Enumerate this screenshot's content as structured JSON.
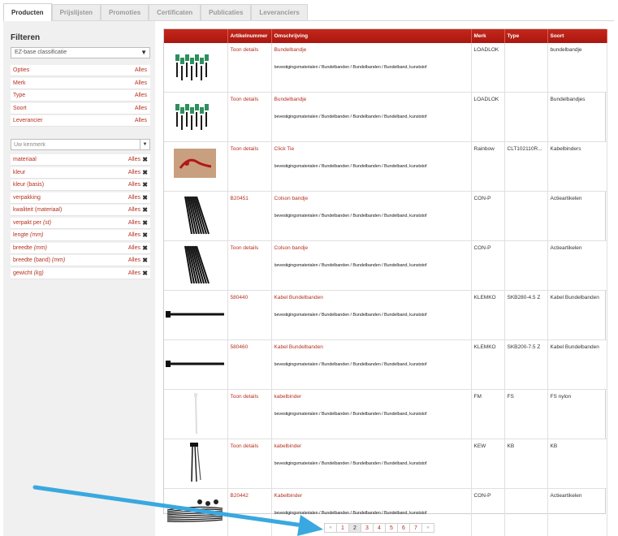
{
  "tabs": [
    {
      "label": "Producten",
      "active": true
    },
    {
      "label": "Prijslijsten",
      "active": false
    },
    {
      "label": "Promoties",
      "active": false
    },
    {
      "label": "Certificaten",
      "active": false
    },
    {
      "label": "Publicaties",
      "active": false
    },
    {
      "label": "Leveranciers",
      "active": false
    }
  ],
  "sidebar": {
    "title": "Filteren",
    "classification_select": "EZ-base classificatie",
    "filters": [
      {
        "label": "Opties",
        "value": "Alles"
      },
      {
        "label": "Merk",
        "value": "Alles"
      },
      {
        "label": "Type",
        "value": "Alles"
      },
      {
        "label": "Soort",
        "value": "Alles"
      },
      {
        "label": "Leverancier",
        "value": "Alles"
      }
    ],
    "kenmerk_placeholder": "Uw kenmerk",
    "kenmerken": [
      {
        "label": "materiaal",
        "unit": "",
        "value": "Alles"
      },
      {
        "label": "kleur",
        "unit": "",
        "value": "Alles"
      },
      {
        "label": "kleur (basis)",
        "unit": "",
        "value": "Alles"
      },
      {
        "label": "verpakking",
        "unit": "",
        "value": "Alles"
      },
      {
        "label": "kwaliteit (materiaal)",
        "unit": "",
        "value": "Alles"
      },
      {
        "label": "verpakt per ",
        "unit": "(st)",
        "value": "Alles"
      },
      {
        "label": "lengte ",
        "unit": "(mm)",
        "value": "Alles"
      },
      {
        "label": "breedte ",
        "unit": "(mm)",
        "value": "Alles"
      },
      {
        "label": "breedte (band) ",
        "unit": "(mm)",
        "value": "Alles"
      },
      {
        "label": "gewicht ",
        "unit": "(kg)",
        "value": "Alles"
      }
    ]
  },
  "table": {
    "headers": [
      "",
      "Artikelnummer",
      "Omschrijving",
      "Merk",
      "Type",
      "Soort"
    ],
    "rows": [
      {
        "image": "bundle-clips",
        "artikel": "Toon details",
        "omschrijving": "Bundelbandje",
        "path": "bevestigingsmaterialen / Bundelbanden / Bundelbanden / Bundelband, kunststof",
        "merk": "LOADLOK",
        "type": "",
        "soort": "bundelbandje"
      },
      {
        "image": "bundle-clips",
        "artikel": "Toon details",
        "omschrijving": "Bundelbandje",
        "path": "bevestigingsmaterialen / Bundelbanden / Bundelbanden / Bundelband, kunststof",
        "merk": "LOADLOK",
        "type": "",
        "soort": "Bundelbandjes"
      },
      {
        "image": "red-tie",
        "artikel": "Toon details",
        "omschrijving": "Click Tie",
        "path": "bevestigingsmaterialen / Bundelbanden / Bundelbanden / Bundelband, kunststof",
        "merk": "Rainbow",
        "type": "CLT102110R...",
        "soort": "Kabelbinders"
      },
      {
        "image": "black-bundle",
        "artikel": "B20451",
        "omschrijving": "Colson bandje",
        "path": "bevestigingsmaterialen / Bundelbanden / Bundelbanden / Bundelband, kunststof",
        "merk": "CON-P",
        "type": "",
        "soort": "Actieartikelen"
      },
      {
        "image": "black-bundle",
        "artikel": "Toon details",
        "omschrijving": "Colson bandje",
        "path": "bevestigingsmaterialen / Bundelbanden / Bundelbanden / Bundelband, kunststof",
        "merk": "CON-P",
        "type": "",
        "soort": "Actieartikelen"
      },
      {
        "image": "single-black",
        "artikel": "580440",
        "omschrijving": "Kabel Bundelbanden",
        "path": "bevestigingsmaterialen / Bundelbanden / Bundelbanden / Bundelband, kunststof",
        "merk": "KLEMKO",
        "type": "SKB280-4.5 Z",
        "soort": "Kabel Bundelbanden"
      },
      {
        "image": "single-black",
        "artikel": "580460",
        "omschrijving": "Kabel Bundelbanden",
        "path": "bevestigingsmaterialen / Bundelbanden / Bundelbanden / Bundelband, kunststof",
        "merk": "KLEMKO",
        "type": "SKB200-7.5 Z",
        "soort": "Kabel Bundelbanden"
      },
      {
        "image": "white-tie",
        "artikel": "Toon details",
        "omschrijving": "kabelbinder",
        "path": "bevestigingsmaterialen / Bundelbanden / Bundelbanden / Bundelband, kunststof",
        "merk": "FM",
        "type": "FS",
        "soort": "FS nylon"
      },
      {
        "image": "black-few",
        "artikel": "Toon details",
        "omschrijving": "kabelbinder",
        "path": "bevestigingsmaterialen / Bundelbanden / Bundelbanden / Bundelband, kunststof",
        "merk": "KEW",
        "type": "KB",
        "soort": "KB"
      },
      {
        "image": "black-pile",
        "artikel": "B20442",
        "omschrijving": "Kabelbinder",
        "path": "bevestigingsmaterialen / Bundelbanden / Bundelbanden / Bundelband, kunststof",
        "merk": "CON-P",
        "type": "",
        "soort": "Actieartikelen"
      }
    ]
  },
  "pager": {
    "prev": "«",
    "pages": [
      "1",
      "2",
      "3",
      "4",
      "5",
      "6",
      "7"
    ],
    "current": "2",
    "next": "»"
  },
  "colors": {
    "header_red": "#b01c12",
    "link_red": "#b5301f",
    "annotation_blue": "#3aa8e0"
  }
}
